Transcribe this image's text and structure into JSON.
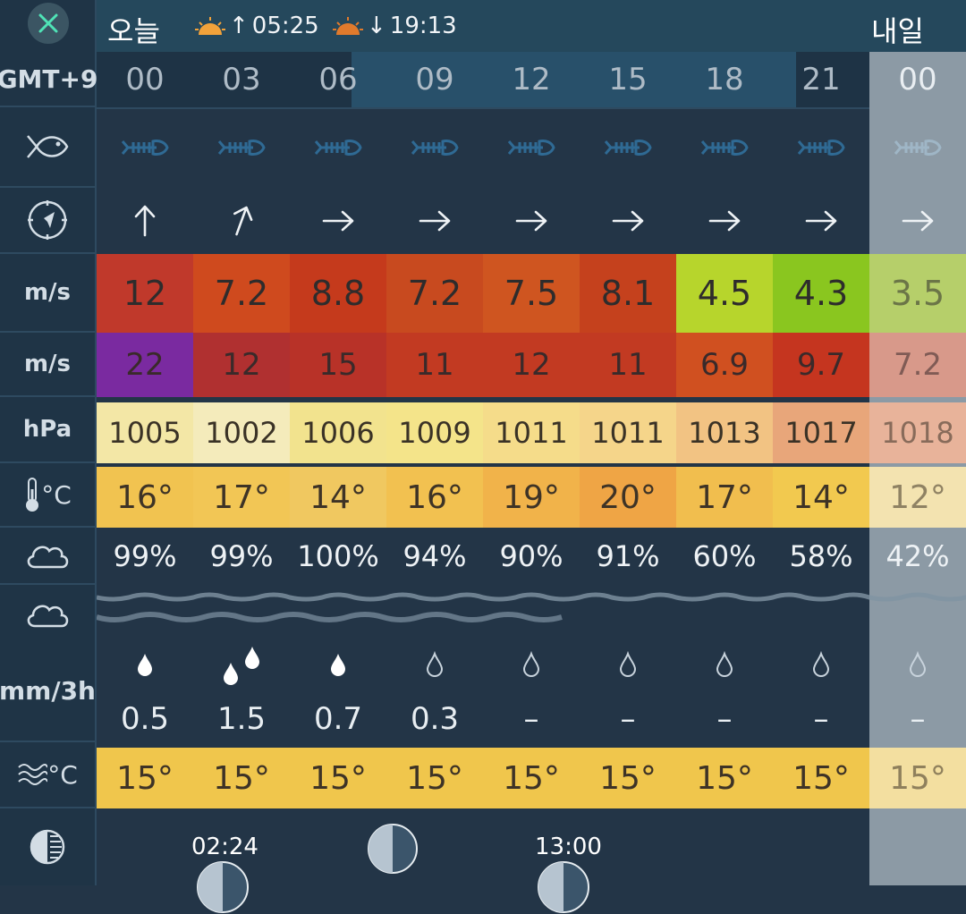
{
  "header": {
    "close_label": "×",
    "today": "오늘",
    "tomorrow": "내일",
    "sunrise": "05:25",
    "sunset": "19:13",
    "timezone": "GMT+9"
  },
  "hours": [
    "00",
    "03",
    "06",
    "09",
    "12",
    "15",
    "18",
    "21"
  ],
  "tomorrow_hour": "00",
  "units": {
    "wind": "m/s",
    "gust": "m/s",
    "pressure": "hPa",
    "temperature": "°C",
    "precip": "mm/3h",
    "sea_temp": "°C"
  },
  "wind_speed": [
    "12",
    "7.2",
    "8.8",
    "7.2",
    "7.5",
    "8.1",
    "4.5",
    "4.3"
  ],
  "wind_speed_tomorrow": "3.5",
  "wind_dir_deg": [
    0,
    20,
    90,
    90,
    90,
    90,
    90,
    90
  ],
  "wind_dir_tomorrow_deg": 90,
  "gusts": [
    "22",
    "12",
    "15",
    "11",
    "12",
    "11",
    "6.9",
    "9.7"
  ],
  "gusts_tomorrow": "7.2",
  "pressure": [
    "1005",
    "1002",
    "1006",
    "1009",
    "1011",
    "1011",
    "1013",
    "1017"
  ],
  "pressure_tomorrow": "1018",
  "temperature": [
    "16°",
    "17°",
    "14°",
    "16°",
    "19°",
    "20°",
    "17°",
    "14°"
  ],
  "temperature_tomorrow": "12°",
  "cloud": [
    "99%",
    "99%",
    "100%",
    "94%",
    "90%",
    "91%",
    "60%",
    "58%"
  ],
  "cloud_tomorrow": "42%",
  "precip": [
    "0.5",
    "1.5",
    "0.7",
    "0.3",
    "–",
    "–",
    "–",
    "–"
  ],
  "precip_tomorrow": "–",
  "precip_drops": [
    "filled",
    "double-filled",
    "filled",
    "outline",
    "outline",
    "outline",
    "outline",
    "outline"
  ],
  "sea_temp": [
    "15°",
    "15°",
    "15°",
    "15°",
    "15°",
    "15°",
    "15°",
    "15°"
  ],
  "sea_temp_tomorrow": "15°",
  "moon": {
    "time1": "02:24",
    "time2": "13:00"
  },
  "colors": {
    "wind_bg": [
      "#c0392b",
      "#cf4a1e",
      "#c53a1c",
      "#c84a1f",
      "#cf5520",
      "#c5411d",
      "#b7d52c",
      "#8ac61f"
    ],
    "wind_tomorrow_bg": "#b6cf6a",
    "gust_bg": [
      "#7a2aa0",
      "#b03030",
      "#b83228",
      "#c23a22",
      "#c23a22",
      "#c23a22",
      "#d05020",
      "#c5351f"
    ],
    "gust_tomorrow_bg": "#d8998a",
    "pressure_bg": [
      "#f3e7a6",
      "#f4ebbb",
      "#f2e38e",
      "#f4e48a",
      "#f5dc8a",
      "#f5d58a",
      "#f2c383",
      "#e8a67a"
    ],
    "pressure_tomorrow_bg": "#e8b39a",
    "temp_bg": [
      "#f1c350",
      "#f2c655",
      "#f0c860",
      "#f2c150",
      "#f1b34a",
      "#efa545",
      "#f1be4e",
      "#f2c94f"
    ],
    "temp_tomorrow_bg": "#f3e3b0",
    "sea_bg": "#f0c64c",
    "sea_tomorrow_bg": "#f3dfa0"
  }
}
